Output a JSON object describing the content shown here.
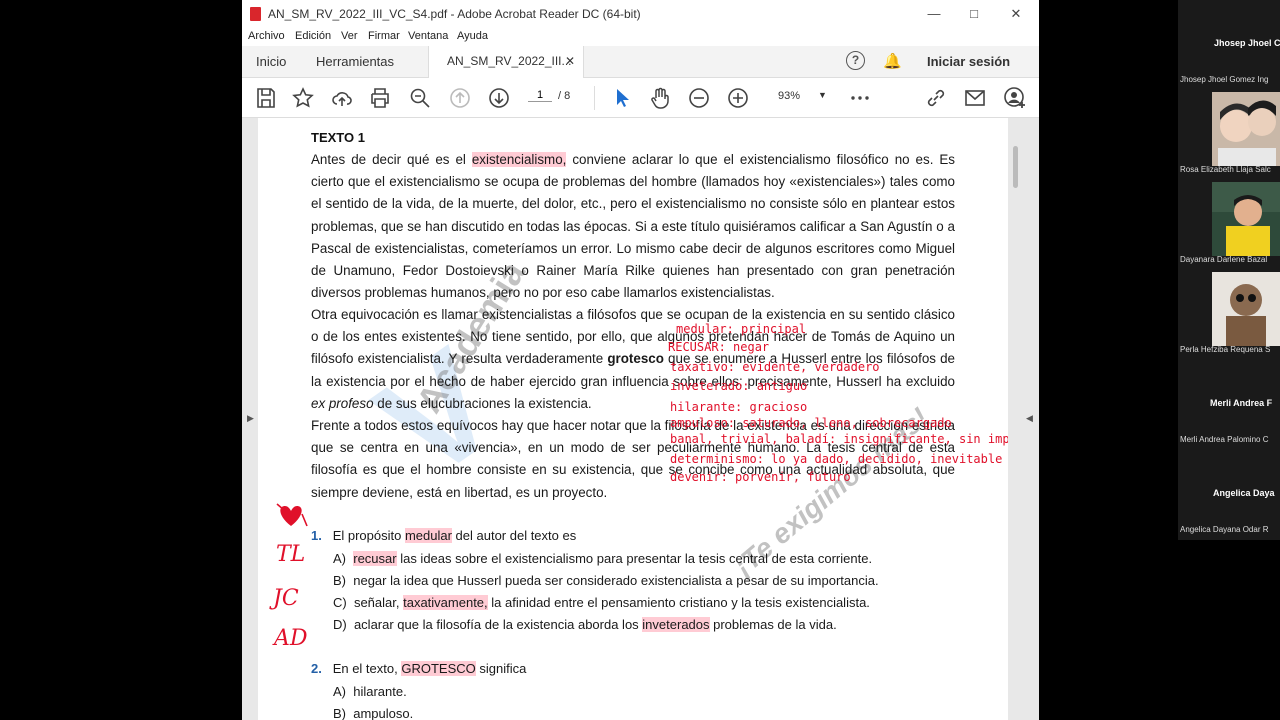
{
  "window": {
    "title": "AN_SM_RV_2022_III_VC_S4.pdf - Adobe Acrobat Reader DC (64-bit)"
  },
  "menu": [
    "Archivo",
    "Edición",
    "Ver",
    "Firmar",
    "Ventana",
    "Ayuda"
  ],
  "tabs": {
    "home": "Inicio",
    "tools": "Herramientas",
    "document": "AN_SM_RV_2022_III...",
    "signin": "Iniciar sesión"
  },
  "toolbar": {
    "page_current": "1",
    "page_total": "/ 8",
    "zoom": "93%"
  },
  "document": {
    "heading": "TEXTO 1",
    "paragraph1_pre": "Antes de decir qué es el ",
    "paragraph1_hl": "existencialismo,",
    "paragraph1_post": " conviene aclarar lo que el existencialismo filosófico no es. Es cierto que el existencialismo se ocupa de problemas del hombre (llamados hoy «existenciales») tales como el sentido de la vida, de la muerte, del dolor, etc., pero el existencialismo no consiste sólo en plantear estos problemas, que se han discutido en todas las épocas. Si a este título quisiéramos calificar a San Agustín o a Pascal de existencialistas, cometeríamos un error. Lo mismo cabe decir de algunos escritores como Miguel de Unamuno, Fedor Dostoievski o Rainer María Rilke quienes han presentado con gran penetración diversos problemas humanos, pero no por eso cabe llamarlos existencialistas.",
    "paragraph2_a": "Otra equivocación es llamar existencialistas a filósofos que se ocupan de la existencia en su sentido clásico o de los entes existentes. No tiene sentido, por ello, que algunos pretendan hacer de Tomás de Aquino un filósofo existencialista. Y resulta verdaderamente ",
    "paragraph2_bold": "grotesco",
    "paragraph2_b": " que se enumere a Husserl entre los filósofos de la existencia por el hecho de haber ejercido gran influencia sobre ellos; precisamente, Husserl ha excluido ",
    "paragraph2_italic": "ex profeso",
    "paragraph2_c": " de sus elucubraciones la existencia.",
    "paragraph3": "Frente a todos estos equívocos hay que hacer notar que la filosofía de la existencia es una dirección estricta que se centra en una «vivencia», en un modo de ser peculiarmente humano. La tesis central de esta filosofía es que el hombre consiste en su existencia, que se concibe como una actualidad absoluta, que siempre deviene, está en libertad, es un proyecto.",
    "q1_num": "1.",
    "q1_pre": "El propósito ",
    "q1_hl": "medular",
    "q1_post": " del autor del texto es",
    "q1_a_label": "A)",
    "q1_a_hl": "recusar",
    "q1_a_post": " las ideas sobre el existencialismo para presentar la tesis central de esta corriente.",
    "q1_b_label": "B)",
    "q1_b": "negar la idea que Husserl pueda ser considerado existencialista a pesar de su importancia.",
    "q1_c_label": "C)",
    "q1_c_pre": "señalar, ",
    "q1_c_hl": "taxativamente,",
    "q1_c_post": " la afinidad entre el pensamiento cristiano y la tesis existencialista.",
    "q1_d_label": "D)",
    "q1_d_pre": "aclarar que la filosofía de la existencia aborda los ",
    "q1_d_hl": "inveterados",
    "q1_d_post": " problemas de la vida.",
    "q2_num": "2.",
    "q2_pre": "En el texto, ",
    "q2_hl": "GROTESCO",
    "q2_post": " significa",
    "q2_a_label": "A)",
    "q2_a": "hilarante.",
    "q2_b_label": "B)",
    "q2_b": "ampuloso."
  },
  "annotations": [
    "medular: principal",
    "RECUSAR: negar",
    "taxativo:   evidente, verdadero",
    "inveterado: antiguo",
    "hilarante: gracioso",
    "ampuloso: saturado, lleno, sobrecargado",
    "banal, trivial, baladí: insignificante, sin importancia",
    "determinismo:   lo ya dado, decidido, inevitable",
    "devenir:    porvenir, futuro"
  ],
  "handwriting": [
    "TL",
    "JC",
    "AD"
  ],
  "watermark": {
    "academia": "Academia",
    "slogan": "¡Te exigimos más!"
  },
  "participants": [
    {
      "label": "Jhosep Jhoel C",
      "name": "Jhosep Jhoel Gomez Ing"
    },
    {
      "label": "",
      "name": "Rosa Elizabeth Llaja Salc"
    },
    {
      "label": "",
      "name": "Dayanara Darlene Bazal"
    },
    {
      "label": "",
      "name": "Perla Hefziba Requena S"
    },
    {
      "label": "Merli Andrea F",
      "name": "Merli Andrea Palomino C"
    },
    {
      "label": "Angelica Daya",
      "name": "Angelica Dayana Odar R"
    }
  ]
}
